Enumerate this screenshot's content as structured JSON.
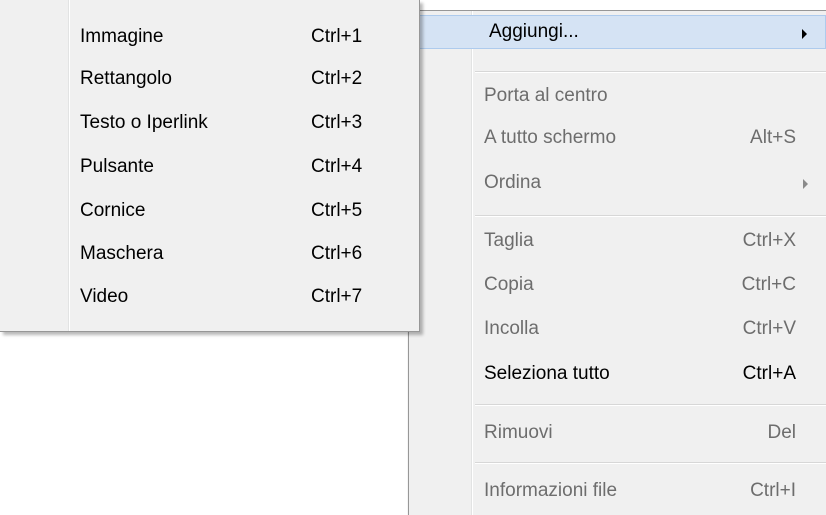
{
  "main_menu": {
    "add": {
      "label": "Aggiungi..."
    },
    "items_group1": [
      {
        "label": "Porta al centro",
        "shortcut": ""
      },
      {
        "label": "A tutto schermo",
        "shortcut": "Alt+S"
      },
      {
        "label": "Ordina",
        "shortcut": ""
      }
    ],
    "items_group2": [
      {
        "label": "Taglia",
        "shortcut": "Ctrl+X"
      },
      {
        "label": "Copia",
        "shortcut": "Ctrl+C"
      },
      {
        "label": "Incolla",
        "shortcut": "Ctrl+V"
      },
      {
        "label": "Seleziona tutto",
        "shortcut": "Ctrl+A"
      }
    ],
    "items_group3": [
      {
        "label": "Rimuovi",
        "shortcut": "Del"
      }
    ],
    "items_group4": [
      {
        "label": "Informazioni file",
        "shortcut": "Ctrl+I"
      }
    ]
  },
  "submenu": {
    "items": [
      {
        "label": "Immagine",
        "shortcut": "Ctrl+1"
      },
      {
        "label": "Rettangolo",
        "shortcut": "Ctrl+2"
      },
      {
        "label": "Testo o Iperlink",
        "shortcut": "Ctrl+3"
      },
      {
        "label": "Pulsante",
        "shortcut": "Ctrl+4"
      },
      {
        "label": "Cornice",
        "shortcut": "Ctrl+5"
      },
      {
        "label": "Maschera",
        "shortcut": "Ctrl+6"
      },
      {
        "label": "Video",
        "shortcut": "Ctrl+7"
      }
    ]
  },
  "icons": {
    "submenu_arrow": "chevron-right-icon"
  },
  "colors": {
    "menu_background": "#f0f0f0",
    "hover_background": "#d5e3f4",
    "hover_border": "#aecbed",
    "disabled_text": "#6d6d6d"
  }
}
